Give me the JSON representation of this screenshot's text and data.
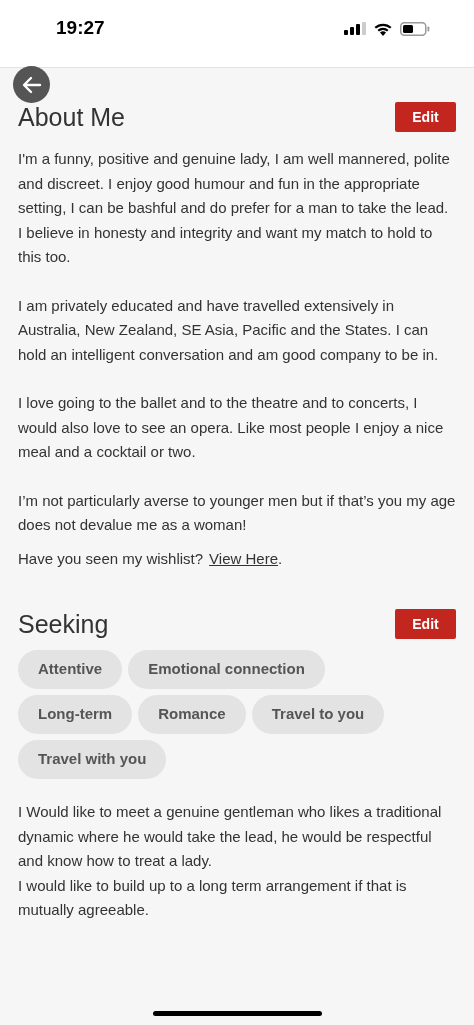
{
  "status_bar": {
    "time": "19:27"
  },
  "about": {
    "title": "About Me",
    "edit_label": "Edit",
    "blocks": [
      [
        "I'm a funny, positive and genuine lady, I am well mannered, polite and discreet. I enjoy good humour and fun in the appropriate setting, I can be bashful and do prefer for a man to take the lead.",
        "I believe in honesty and integrity and want my match to hold to this too."
      ],
      [
        "I am privately educated and have travelled extensively in Australia, New Zealand, SE Asia, Pacific and the States. I can hold an intelligent conversation and am good company to be in."
      ],
      [
        "I love going to the ballet and to the theatre and to concerts, I would also love to see an opera. Like most people I enjoy a nice meal and a cocktail or two."
      ],
      [
        "I’m not particularly averse to younger men but if that’s you my age does not devalue me as a woman!"
      ]
    ],
    "wishlist": {
      "text": "Have you seen my wishlist?",
      "link": "View Here",
      "end": "."
    }
  },
  "seeking": {
    "title": "Seeking",
    "edit_label": "Edit",
    "tags": [
      "Attentive",
      "Emotional connection",
      "Long-term",
      "Romance",
      "Travel to you",
      "Travel with you"
    ],
    "lines": [
      "I Would like to meet a genuine gentleman who likes a traditional dynamic where he would take the lead, he would be respectful and know how to treat a lady.",
      "I would like to build up to a long term arrangement if that is mutually agreeable."
    ]
  }
}
